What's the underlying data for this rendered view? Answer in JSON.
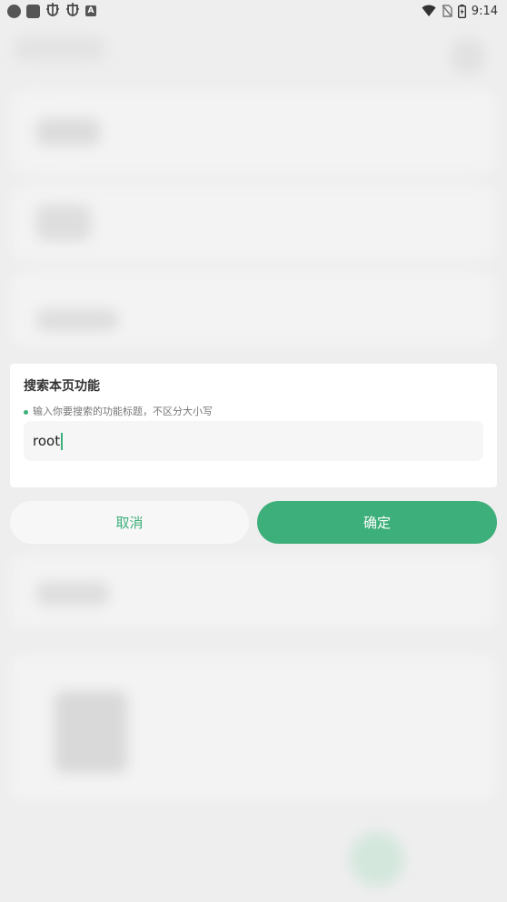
{
  "status_bar": {
    "time": "9:14",
    "left_icons": [
      "dot-icon",
      "app-square-icon",
      "bug-icon",
      "bug-icon",
      "a-icon"
    ],
    "right_icons": [
      "wifi-icon",
      "no-sim-icon",
      "battery-icon"
    ]
  },
  "dialog": {
    "title": "搜索本页功能",
    "hint": "输入你要搜索的功能标题，不区分大小写",
    "input_value": "root"
  },
  "buttons": {
    "cancel_label": "取消",
    "confirm_label": "确定"
  },
  "colors": {
    "accent": "#3daf7a",
    "background": "#eeeeee",
    "card": "#ffffff"
  }
}
